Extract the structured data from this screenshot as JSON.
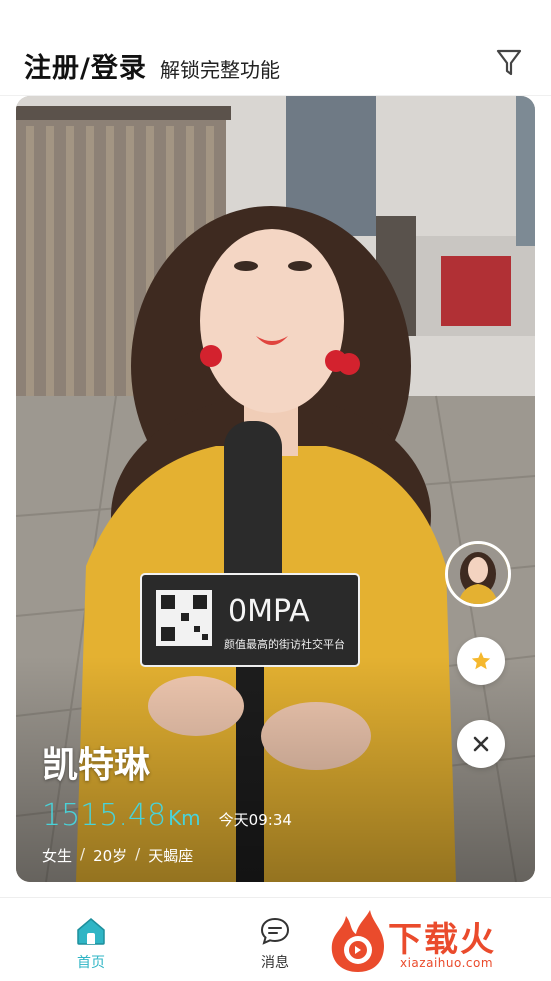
{
  "header": {
    "title": "注册/登录",
    "subtitle": "解锁完整功能",
    "filter_icon": "filter-icon"
  },
  "card": {
    "name": "凯特琳",
    "distance_value": "1515.48",
    "distance_unit": "Km",
    "time": "今天09:34",
    "gender": "女生",
    "age": "20岁",
    "zodiac": "天蝎座",
    "separator": "/",
    "photo_sign_brand": "0MPA",
    "photo_sign_slogan": "颜值最高的街访社交平台"
  },
  "actions": {
    "star_icon": "star-icon",
    "close_icon": "close-icon",
    "star_color": "#f5b82e"
  },
  "tabbar": {
    "home_label": "首页",
    "messages_label": "消息",
    "active_color": "#2fb5c5"
  },
  "watermark": {
    "brand": "下载火",
    "url": "xiazaihuo.com"
  }
}
